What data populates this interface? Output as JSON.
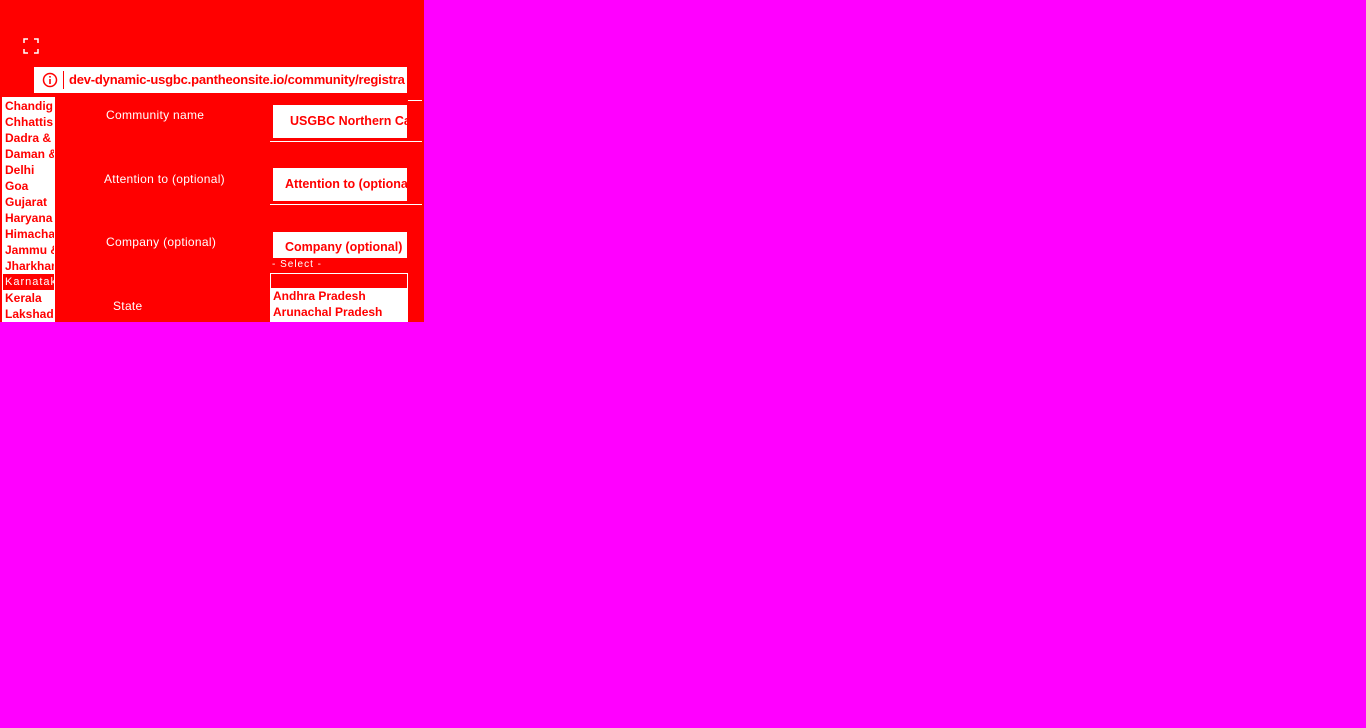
{
  "browser": {
    "url": "dev-dynamic-usgbc.pantheonsite.io/community/registra"
  },
  "left_list": {
    "options": [
      "Chandig",
      "Chhattis",
      "Dadra &",
      "Daman &",
      "Delhi",
      "Goa",
      "Gujarat",
      "Haryana",
      "Himacha",
      "Jammu &",
      "Jharkhan",
      "Karnatak",
      "Kerala",
      "Lakshad"
    ],
    "selected_index": 11
  },
  "form": {
    "community_label": "Community name",
    "community_value": "USGBC Northern Ca",
    "attention_label": "Attention to (optional)",
    "attention_placeholder": "Attention to (optional)",
    "company_label": "Company (optional)",
    "company_placeholder": "Company (optional)",
    "state_label": "State",
    "state_small_label": "- Select -",
    "state_options": [
      "- Select -",
      "Andhra Pradesh",
      "Arunachal Pradesh"
    ]
  },
  "colors": {
    "background": "#ff00ff",
    "panel": "#ff0000",
    "field": "#ffffff"
  }
}
